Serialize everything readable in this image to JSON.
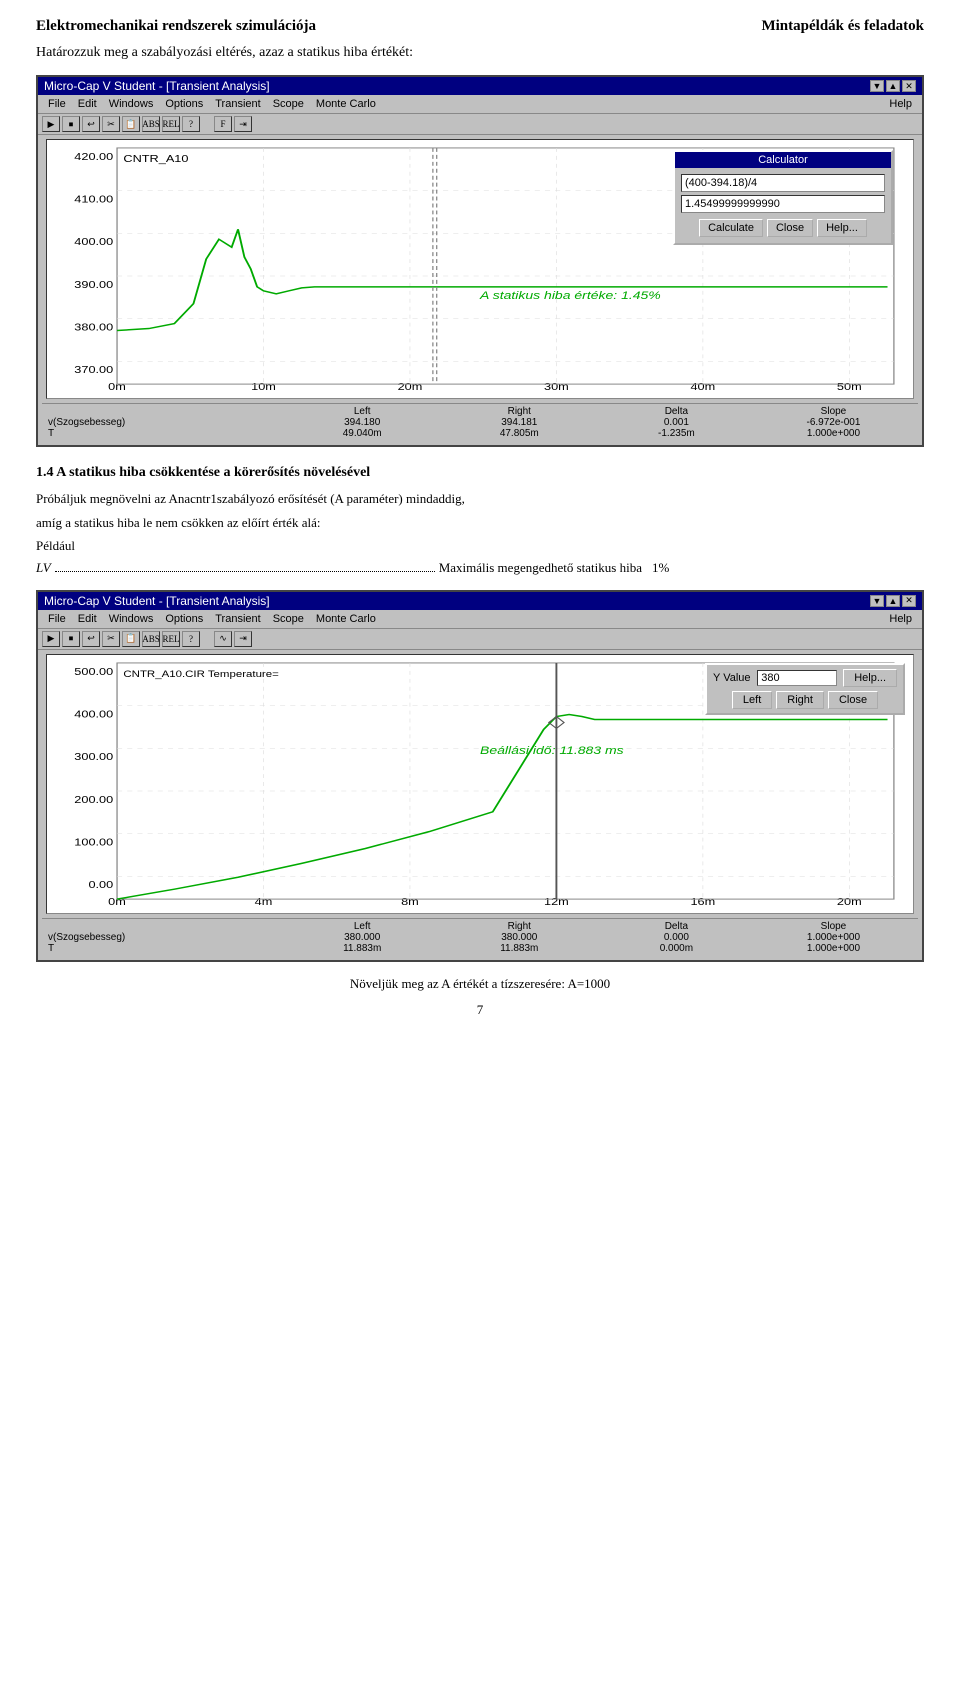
{
  "header": {
    "left": "Elektromechanikai rendszerek szimulációja",
    "right": "Mintapéldák és feladatok"
  },
  "intro": "Határozzuk meg  a szabályozási eltérés, azaz a statikus hiba értékét:",
  "window1": {
    "title": "Micro-Cap V Student - [Transient Analysis]",
    "menu": [
      "File",
      "Edit",
      "Windows",
      "Options",
      "Transient",
      "Scope",
      "Monte Carlo",
      "Help"
    ],
    "curve_label": "CNTR_A10",
    "calculator": {
      "title": "Calculator",
      "input": "(400-394.18)/4",
      "result": "1.45499999999990",
      "buttons": [
        "Calculate",
        "Close",
        "Help..."
      ]
    },
    "annotation": "A statikus hiba értéke: 1.45%",
    "yaxis": [
      "420.00",
      "410.00",
      "400.00",
      "390.00",
      "380.00",
      "370.00"
    ],
    "xaxis": [
      "0m",
      "10m",
      "20m",
      "30m",
      "40m",
      "50m"
    ],
    "status": {
      "headers": [
        "",
        "Left",
        "Right",
        "Delta",
        "Slope"
      ],
      "row1_label": "v(Szogsebesseg)",
      "row1_vals": [
        "394.180",
        "394.181",
        "0.001",
        "-6.972e-001"
      ],
      "row2_label": "T",
      "row2_vals": [
        "49.040m",
        "47.805m",
        "-1.235m",
        "1.000e+000"
      ]
    }
  },
  "section1": {
    "heading": "1.4 A statikus hiba csökkentése a körerősítés növelésével",
    "text1": "Próbáljuk megnövelni az Anacntr1szabályozó erősítését (A paraméter) mindaddig,",
    "text2": "amíg a statikus hiba le nem csökken az előírt érték alá:",
    "text3": "Például",
    "lv_label": "LV",
    "lv_dots": "...",
    "lv_value": "Maximális megengedhető statikus hiba",
    "lv_percent": "1%"
  },
  "window2": {
    "title": "Micro-Cap V Student - [Transient Analysis]",
    "menu": [
      "File",
      "Edit",
      "Windows",
      "Options",
      "Transient",
      "Scope",
      "Monte Carlo",
      "Help"
    ],
    "curve_label": "CNTR_A10.CIR Temperature=",
    "cursor": {
      "y_label": "Y Value",
      "y_value": "380",
      "help_btn": "Help...",
      "left_btn": "Left",
      "right_btn": "Right",
      "close_btn": "Close"
    },
    "annotation": "Beállási idő: 11.883 ms",
    "yaxis": [
      "500.00",
      "400.00",
      "300.00",
      "200.00",
      "100.00",
      "0.00"
    ],
    "xaxis": [
      "0m",
      "4m",
      "8m",
      "12m",
      "16m",
      "20m"
    ],
    "status": {
      "headers": [
        "",
        "Left",
        "Right",
        "Delta",
        "Slope"
      ],
      "row1_label": "v(Szogsebesseg)",
      "row1_vals": [
        "380.000",
        "380.000",
        "0.000",
        "1.000e+000"
      ],
      "row2_label": "T",
      "row2_vals": [
        "11.883m",
        "11.883m",
        "0.000m",
        "1.000e+000"
      ]
    }
  },
  "footer": {
    "text": "Növeljük meg az A értékét a tízszeresére: A=1000",
    "page": "7"
  }
}
